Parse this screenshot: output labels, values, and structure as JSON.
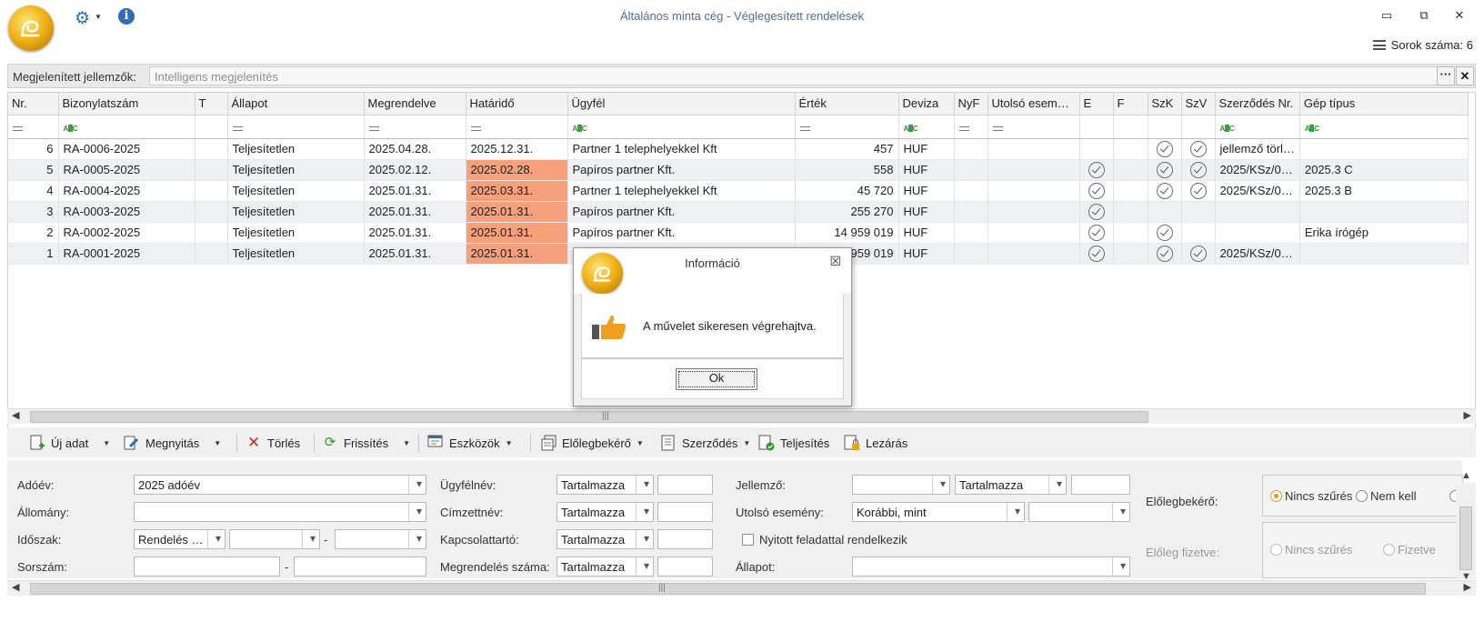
{
  "window": {
    "title": "Általános minta cég - Véglegesített rendelések",
    "row_count_label": "Sorok száma: 6"
  },
  "attributes": {
    "label": "Megjelenített jellemzők:",
    "placeholder": "Intelligens megjelenítés",
    "more_label": "···",
    "clear_label": "✕"
  },
  "grid": {
    "columns": [
      "Nr.",
      "Bizonylatszám",
      "T",
      "Állapot",
      "Megrendelve",
      "Határidő",
      "Ügyfél",
      "Érték",
      "Deviza",
      "NyF",
      "Utolsó esem…",
      "E",
      "F",
      "SzK",
      "SzV",
      "Szerződés Nr.",
      "Gép típus"
    ],
    "rows": [
      {
        "nr": "6",
        "num": "RA-0006-2025",
        "t": "",
        "status": "Teljesítetlen",
        "ordered": "2025.04.28.",
        "deadline": "2025.12.31.",
        "deadline_overdue": false,
        "customer": "Partner 1 telephelyekkel Kft",
        "value": "457",
        "currency": "HUF",
        "nyf": "",
        "last_event": "",
        "e": false,
        "f": false,
        "szk": true,
        "szv": true,
        "contract": "jellemző törl…",
        "machine": ""
      },
      {
        "nr": "5",
        "num": "RA-0005-2025",
        "t": "",
        "status": "Teljesítetlen",
        "ordered": "2025.02.12.",
        "deadline": "2025.02.28.",
        "deadline_overdue": true,
        "customer": "Papíros partner Kft.",
        "value": "558",
        "currency": "HUF",
        "nyf": "",
        "last_event": "",
        "e": true,
        "f": false,
        "szk": true,
        "szv": true,
        "contract": "2025/KSz/0…",
        "machine": "2025.3 C"
      },
      {
        "nr": "4",
        "num": "RA-0004-2025",
        "t": "",
        "status": "Teljesítetlen",
        "ordered": "2025.01.31.",
        "deadline": "2025.03.31.",
        "deadline_overdue": true,
        "customer": "Partner 1 telephelyekkel Kft",
        "value": "45 720",
        "currency": "HUF",
        "nyf": "",
        "last_event": "",
        "e": true,
        "f": false,
        "szk": true,
        "szv": true,
        "contract": "2025/KSz/0…",
        "machine": "2025.3 B"
      },
      {
        "nr": "3",
        "num": "RA-0003-2025",
        "t": "",
        "status": "Teljesítetlen",
        "ordered": "2025.01.31.",
        "deadline": "2025.01.31.",
        "deadline_overdue": true,
        "customer": "Papíros partner Kft.",
        "value": "255 270",
        "currency": "HUF",
        "nyf": "",
        "last_event": "",
        "e": true,
        "f": false,
        "szk": false,
        "szv": false,
        "contract": "",
        "machine": ""
      },
      {
        "nr": "2",
        "num": "RA-0002-2025",
        "t": "",
        "status": "Teljesítetlen",
        "ordered": "2025.01.31.",
        "deadline": "2025.01.31.",
        "deadline_overdue": true,
        "customer": "Papíros partner Kft.",
        "value": "14 959 019",
        "currency": "HUF",
        "nyf": "",
        "last_event": "",
        "e": true,
        "f": false,
        "szk": true,
        "szv": false,
        "contract": "",
        "machine": "Erika írógép"
      },
      {
        "nr": "1",
        "num": "RA-0001-2025",
        "t": "",
        "status": "Teljesítetlen",
        "ordered": "2025.01.31.",
        "deadline": "2025.01.31.",
        "deadline_overdue": true,
        "customer": "",
        "value": "959 019",
        "currency": "HUF",
        "nyf": "",
        "last_event": "",
        "e": true,
        "f": false,
        "szk": true,
        "szv": true,
        "contract": "2025/KSz/0…",
        "machine": ""
      }
    ],
    "overdue_color": "#f6a07c",
    "scroll_grip": "|||"
  },
  "toolbar": {
    "new": "Új adat",
    "open": "Megnyitás",
    "delete": "Törlés",
    "refresh": "Frissítés",
    "tools": "Eszközök",
    "advance": "Előlegbekérő",
    "contract": "Szerződés",
    "fulfil": "Teljesítés",
    "close": "Lezárás"
  },
  "filters": {
    "tax_year_label": "Adóév:",
    "tax_year_value": "2025 adóév",
    "stock_label": "Állomány:",
    "period_label": "Időszak:",
    "period_value": "Rendelés …",
    "dash": "-",
    "serial_label": "Sorszám:",
    "customer_label": "Ügyfélnév:",
    "recipient_label": "Címzettnév:",
    "contact_label": "Kapcsolattartó:",
    "order_no_label": "Megrendelés száma:",
    "contains": "Tartalmazza",
    "attribute_label": "Jellemző:",
    "last_event_label": "Utolsó esemény:",
    "last_event_value": "Korábbi, mint",
    "open_task_label": "Nyitott feladattal rendelkezik",
    "status_label": "Állapot:",
    "advance_label": "Előlegbekérő:",
    "advance_paid_label": "Előleg fizetve:",
    "no_filter": "Nincs szűrés",
    "not_needed": "Nem kell",
    "paid": "Fizetve"
  },
  "dialog": {
    "title": "Információ",
    "message": "A művelet sikeresen végrehajtva.",
    "ok": "Ok"
  },
  "colors": {
    "accent": "#2f6db5",
    "logo_gold": "#f2b418",
    "radio_selected": "#e59e14"
  }
}
